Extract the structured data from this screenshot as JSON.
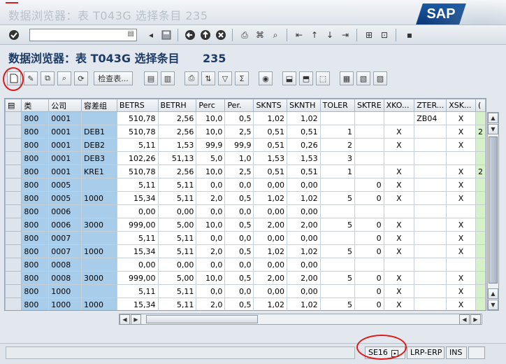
{
  "window": {
    "title": "数据浏览器：表 T043G 选择条目          235",
    "logo": "SAP"
  },
  "screen": {
    "title": "数据浏览器：表 T043G 选择条目",
    "count": "235"
  },
  "toolbar": {
    "check_table_label": "检查表..."
  },
  "table": {
    "columns": [
      "类",
      "公司",
      "容差组",
      "BETRS",
      "BETRH",
      "Perc",
      "Per.",
      "SKNTS",
      "SKNTH",
      "TOLER",
      "SKTRE",
      "XKO...",
      "ZTER...",
      "XSK...",
      "("
    ],
    "rows": [
      [
        "800",
        "0001",
        "",
        "510,78",
        "2,56",
        "10,0",
        "0,5",
        "1,02",
        "1,02",
        "",
        "",
        "",
        "ZB04",
        "X",
        ""
      ],
      [
        "800",
        "0001",
        "DEB1",
        "510,78",
        "2,56",
        "10,0",
        "2,5",
        "0,51",
        "0,51",
        "1",
        "",
        "X",
        "",
        "X",
        "2"
      ],
      [
        "800",
        "0001",
        "DEB2",
        "5,11",
        "1,53",
        "99,9",
        "99,9",
        "0,51",
        "0,26",
        "2",
        "",
        "X",
        "",
        "X",
        ""
      ],
      [
        "800",
        "0001",
        "DEB3",
        "102,26",
        "51,13",
        "5,0",
        "1,0",
        "1,53",
        "1,53",
        "3",
        "",
        "",
        "",
        "",
        ""
      ],
      [
        "800",
        "0001",
        "KRE1",
        "510,78",
        "2,56",
        "10,0",
        "2,5",
        "0,51",
        "0,51",
        "1",
        "",
        "X",
        "",
        "X",
        "2"
      ],
      [
        "800",
        "0005",
        "",
        "5,11",
        "5,11",
        "0,0",
        "0,0",
        "0,00",
        "0,00",
        "",
        "0",
        "X",
        "",
        "X",
        ""
      ],
      [
        "800",
        "0005",
        "1000",
        "15,34",
        "5,11",
        "2,0",
        "0,5",
        "1,02",
        "1,02",
        "5",
        "0",
        "X",
        "",
        "X",
        ""
      ],
      [
        "800",
        "0006",
        "",
        "0,00",
        "0,00",
        "0,0",
        "0,0",
        "0,00",
        "0,00",
        "",
        "",
        "",
        "",
        "",
        ""
      ],
      [
        "800",
        "0006",
        "3000",
        "999,00",
        "5,00",
        "10,0",
        "0,5",
        "2,00",
        "2,00",
        "5",
        "0",
        "X",
        "",
        "X",
        ""
      ],
      [
        "800",
        "0007",
        "",
        "5,11",
        "5,11",
        "0,0",
        "0,0",
        "0,00",
        "0,00",
        "",
        "0",
        "X",
        "",
        "X",
        ""
      ],
      [
        "800",
        "0007",
        "1000",
        "15,34",
        "5,11",
        "2,0",
        "0,5",
        "1,02",
        "1,02",
        "5",
        "0",
        "X",
        "",
        "X",
        ""
      ],
      [
        "800",
        "0008",
        "",
        "0,00",
        "0,00",
        "0,0",
        "0,0",
        "0,00",
        "0,00",
        "",
        "",
        "",
        "",
        "",
        ""
      ],
      [
        "800",
        "0008",
        "3000",
        "999,00",
        "5,00",
        "10,0",
        "0,5",
        "2,00",
        "2,00",
        "5",
        "0",
        "X",
        "",
        "X",
        ""
      ],
      [
        "800",
        "1000",
        "",
        "5,11",
        "5,11",
        "0,0",
        "0,0",
        "0,00",
        "0,00",
        "",
        "0",
        "X",
        "",
        "X",
        ""
      ],
      [
        "800",
        "1000",
        "1000",
        "15,34",
        "5,11",
        "2,0",
        "0,5",
        "1,02",
        "1,02",
        "5",
        "0",
        "X",
        "",
        "X",
        ""
      ]
    ]
  },
  "status": {
    "transaction": "SE16",
    "system": "LRP-ERP",
    "mode": "INS"
  },
  "icons": [
    "check-icon",
    "back-icon",
    "exit-icon",
    "cancel-icon",
    "print-icon",
    "find-icon",
    "create-icon",
    "edit-icon"
  ]
}
